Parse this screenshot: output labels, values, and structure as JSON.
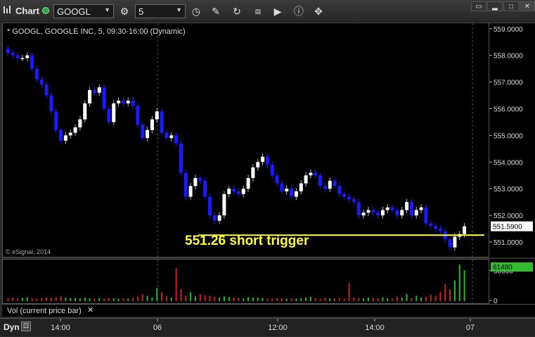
{
  "toolbar": {
    "app_title": "Chart",
    "symbol_value": "GOOGL",
    "interval_value": "5",
    "icons": [
      "settings-icon",
      "clock-icon",
      "pencil-icon",
      "refresh-icon",
      "quote-icon",
      "play-icon",
      "info-icon",
      "tools-icon"
    ]
  },
  "chart_header": {
    "symbol_line": "* GOOGL, GOOGLE INC, 5, 09:30-16:00 (Dynamic)",
    "copyright": "© eSignal, 2014"
  },
  "annotation": {
    "text": "551.26 short trigger",
    "level": 551.26,
    "color": "#ffff33"
  },
  "volume_panel": {
    "caption": "Vol (current price bar)",
    "current_label": "61480",
    "axis_ticks": [
      "50000",
      "0"
    ]
  },
  "time_axis": {
    "dyn_label": "Dyn",
    "ticks": [
      "14:00",
      "06",
      "12:00",
      "14:00",
      "07"
    ]
  },
  "colors": {
    "up_candle": "#ffffff",
    "down_candle": "#1a1aff",
    "volume_up": "#22bb22",
    "volume_down": "#cc2222",
    "price_marker": "#ffffff",
    "volume_marker": "#33bb33"
  },
  "chart_data": {
    "type": "candlestick",
    "title": "GOOGL, GOOGLE INC, 5, 09:30-16:00 (Dynamic)",
    "y_ticks": [
      "559.0000",
      "558.0000",
      "557.0000",
      "556.0000",
      "555.0000",
      "554.0000",
      "553.0000",
      "552.0000",
      "551.0000"
    ],
    "ylim": [
      550.5,
      559.1
    ],
    "last_price_label": "551.5900",
    "last_price": 551.59,
    "trigger_level": 551.26,
    "closes": [
      558.1,
      558.0,
      557.9,
      557.9,
      558.0,
      557.5,
      557.1,
      556.9,
      556.5,
      555.9,
      555.2,
      554.8,
      555.0,
      555.1,
      555.3,
      555.6,
      556.2,
      556.7,
      556.6,
      556.8,
      556.0,
      555.5,
      556.2,
      556.3,
      556.2,
      556.3,
      556.1,
      555.4,
      554.9,
      555.2,
      555.6,
      555.9,
      555.1,
      554.9,
      555.0,
      554.7,
      553.6,
      552.7,
      553.1,
      553.4,
      553.3,
      552.7,
      552.0,
      551.8,
      552.0,
      552.8,
      553.0,
      552.9,
      552.8,
      553.0,
      553.4,
      553.8,
      554.0,
      554.2,
      553.9,
      553.5,
      553.2,
      552.9,
      553.0,
      552.7,
      552.9,
      553.2,
      553.5,
      553.6,
      553.5,
      553.1,
      553.0,
      553.3,
      553.1,
      552.8,
      552.7,
      552.6,
      552.5,
      552.0,
      552.1,
      552.2,
      552.1,
      552.0,
      552.2,
      552.3,
      552.2,
      552.0,
      552.2,
      552.5,
      552.0,
      552.2,
      552.3,
      551.7,
      551.6,
      551.5,
      551.4,
      551.1,
      550.8,
      551.2,
      551.3,
      551.59
    ],
    "volume_ylim": [
      0,
      65000
    ],
    "volumes": [
      5000,
      6000,
      4500,
      5500,
      6500,
      5000,
      4000,
      5200,
      6000,
      5500,
      7000,
      8000,
      6000,
      5000,
      5500,
      4800,
      6000,
      5000,
      4500,
      5200,
      4000,
      5000,
      4800,
      4200,
      5000,
      4500,
      5500,
      7000,
      12000,
      9000,
      6000,
      22000,
      15000,
      8000,
      6000,
      55000,
      20000,
      9000,
      15000,
      8000,
      12000,
      10000,
      9000,
      7000,
      6000,
      8000,
      7000,
      6000,
      5500,
      5000,
      7000,
      6000,
      5500,
      5000,
      4500,
      4000,
      5000,
      4500,
      4000,
      5000,
      4500,
      5000,
      6000,
      7000,
      5000,
      4000,
      5500,
      5000,
      4500,
      5000,
      4000,
      30000,
      6000,
      5000,
      4500,
      6000,
      5500,
      5000,
      6500,
      5000,
      4000,
      8000,
      6000,
      12000,
      5000,
      9000,
      6000,
      7000,
      11000,
      9000,
      15000,
      28000,
      20000,
      35000,
      61480,
      52000
    ]
  }
}
